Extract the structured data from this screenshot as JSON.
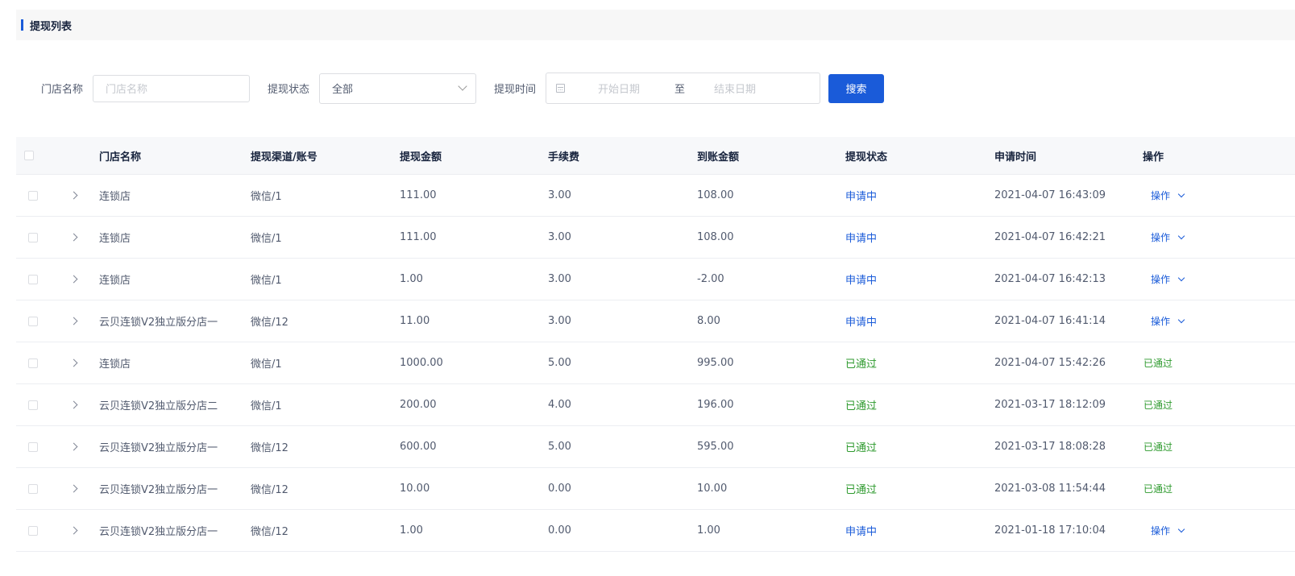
{
  "section": {
    "title": "提现列表"
  },
  "filters": {
    "store_label": "门店名称",
    "store_placeholder": "门店名称",
    "status_label": "提现状态",
    "status_value": "全部",
    "time_label": "提现时间",
    "start_placeholder": "开始日期",
    "range_sep": "至",
    "end_placeholder": "结束日期",
    "search_label": "搜索"
  },
  "table": {
    "headers": [
      "门店名称",
      "提现渠道/账号",
      "提现金额",
      "手续费",
      "到账金额",
      "提现状态",
      "申请时间",
      "操作"
    ],
    "rows": [
      {
        "store": "连锁店",
        "channel": "微信/1",
        "amount": "111.00",
        "fee": "3.00",
        "received": "108.00",
        "status": "申请中",
        "time": "2021-04-07 16:43:09",
        "action": "操作"
      },
      {
        "store": "连锁店",
        "channel": "微信/1",
        "amount": "111.00",
        "fee": "3.00",
        "received": "108.00",
        "status": "申请中",
        "time": "2021-04-07 16:42:21",
        "action": "操作"
      },
      {
        "store": "连锁店",
        "channel": "微信/1",
        "amount": "1.00",
        "fee": "3.00",
        "received": "-2.00",
        "status": "申请中",
        "time": "2021-04-07 16:42:13",
        "action": "操作"
      },
      {
        "store": "云贝连锁V2独立版分店一",
        "channel": "微信/12",
        "amount": "11.00",
        "fee": "3.00",
        "received": "8.00",
        "status": "申请中",
        "time": "2021-04-07 16:41:14",
        "action": "操作"
      },
      {
        "store": "连锁店",
        "channel": "微信/1",
        "amount": "1000.00",
        "fee": "5.00",
        "received": "995.00",
        "status": "已通过",
        "time": "2021-04-07 15:42:26",
        "action": "已通过"
      },
      {
        "store": "云贝连锁V2独立版分店二",
        "channel": "微信/1",
        "amount": "200.00",
        "fee": "4.00",
        "received": "196.00",
        "status": "已通过",
        "time": "2021-03-17 18:12:09",
        "action": "已通过"
      },
      {
        "store": "云贝连锁V2独立版分店一",
        "channel": "微信/12",
        "amount": "600.00",
        "fee": "5.00",
        "received": "595.00",
        "status": "已通过",
        "time": "2021-03-17 18:08:28",
        "action": "已通过"
      },
      {
        "store": "云贝连锁V2独立版分店一",
        "channel": "微信/12",
        "amount": "10.00",
        "fee": "0.00",
        "received": "10.00",
        "status": "已通过",
        "time": "2021-03-08 11:54:44",
        "action": "已通过"
      },
      {
        "store": "云贝连锁V2独立版分店一",
        "channel": "微信/12",
        "amount": "1.00",
        "fee": "0.00",
        "received": "1.00",
        "status": "申请中",
        "time": "2021-01-18 17:10:04",
        "action": "操作"
      }
    ]
  },
  "colors": {
    "primary": "#1a5bd9",
    "passed": "#2e9a2e"
  },
  "icons": {
    "calendar": "calendar-icon",
    "select": "chevron-down-icon",
    "expand": "chevron-right-icon"
  }
}
